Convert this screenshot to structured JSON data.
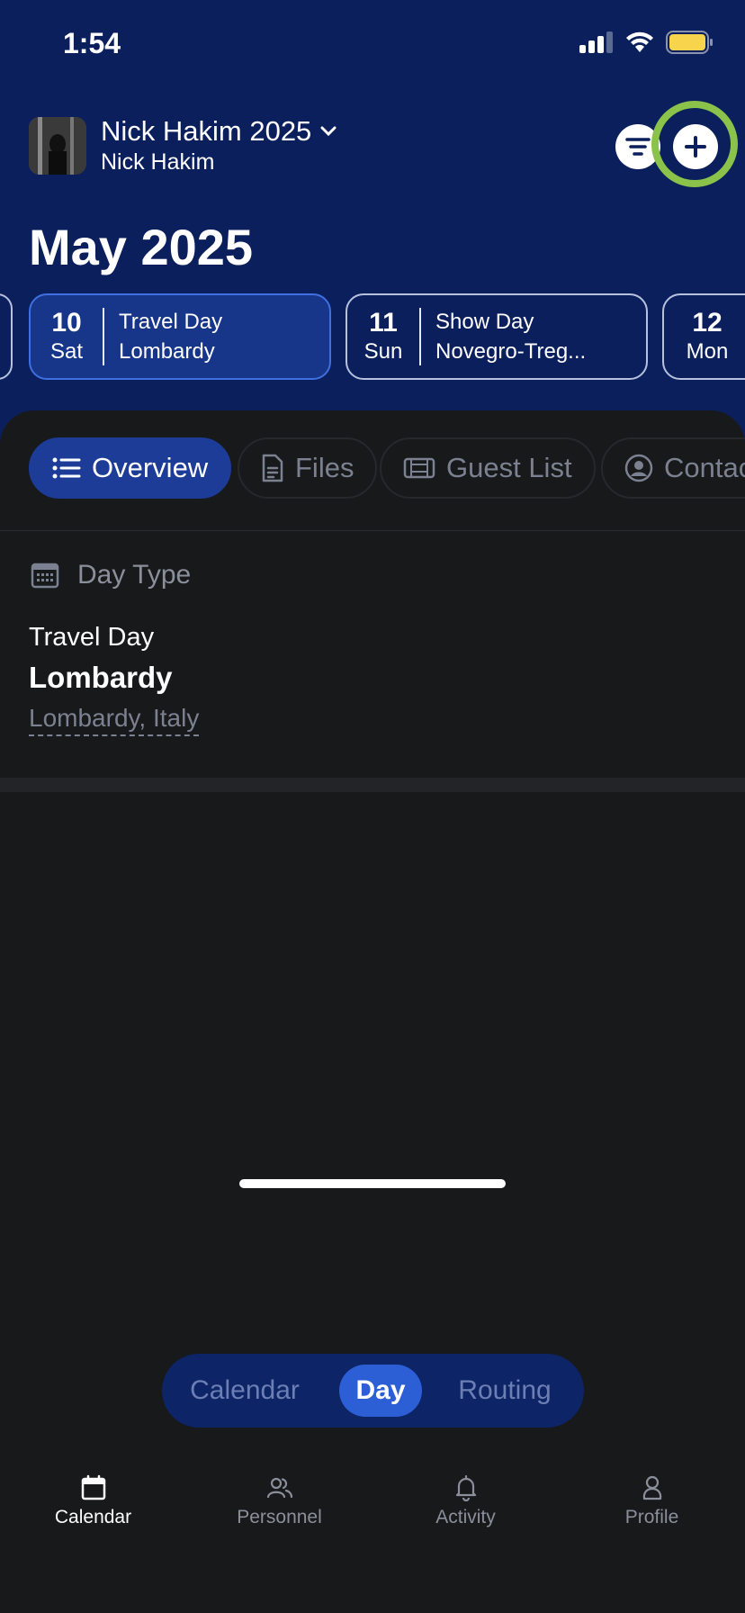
{
  "status": {
    "time": "1:54"
  },
  "header": {
    "tour_title": "Nick Hakim 2025",
    "tour_subtitle": "Nick Hakim",
    "month_title": "May 2025"
  },
  "days": [
    {
      "num": "10",
      "weekday": "Sat",
      "type": "Travel Day",
      "place": "Lombardy",
      "active": true
    },
    {
      "num": "11",
      "weekday": "Sun",
      "type": "Show Day",
      "place": "Novegro-Treg...",
      "active": false
    },
    {
      "num": "12",
      "weekday": "Mon",
      "type": "",
      "place": "",
      "active": false
    }
  ],
  "tabs": [
    {
      "label": "Overview",
      "icon": "list-icon",
      "active": true
    },
    {
      "label": "Files",
      "icon": "file-icon",
      "active": false
    },
    {
      "label": "Guest List",
      "icon": "ticket-icon",
      "active": false
    },
    {
      "label": "Contac",
      "icon": "contact-icon",
      "active": false
    }
  ],
  "day_type": {
    "heading": "Day Type",
    "type": "Travel Day",
    "name": "Lombardy",
    "location": "Lombardy, Italy"
  },
  "view_switch": [
    {
      "label": "Calendar",
      "active": false
    },
    {
      "label": "Day",
      "active": true
    },
    {
      "label": "Routing",
      "active": false
    }
  ],
  "tabbar": [
    {
      "label": "Calendar",
      "icon": "calendar-icon",
      "active": true
    },
    {
      "label": "Personnel",
      "icon": "people-icon",
      "active": false
    },
    {
      "label": "Activity",
      "icon": "bell-icon",
      "active": false
    },
    {
      "label": "Profile",
      "icon": "person-icon",
      "active": false
    }
  ],
  "colors": {
    "header_bg": "#0b1f5c",
    "accent": "#2c5fd6",
    "highlight_ring": "#8bc34a",
    "content_bg": "#18191b"
  }
}
